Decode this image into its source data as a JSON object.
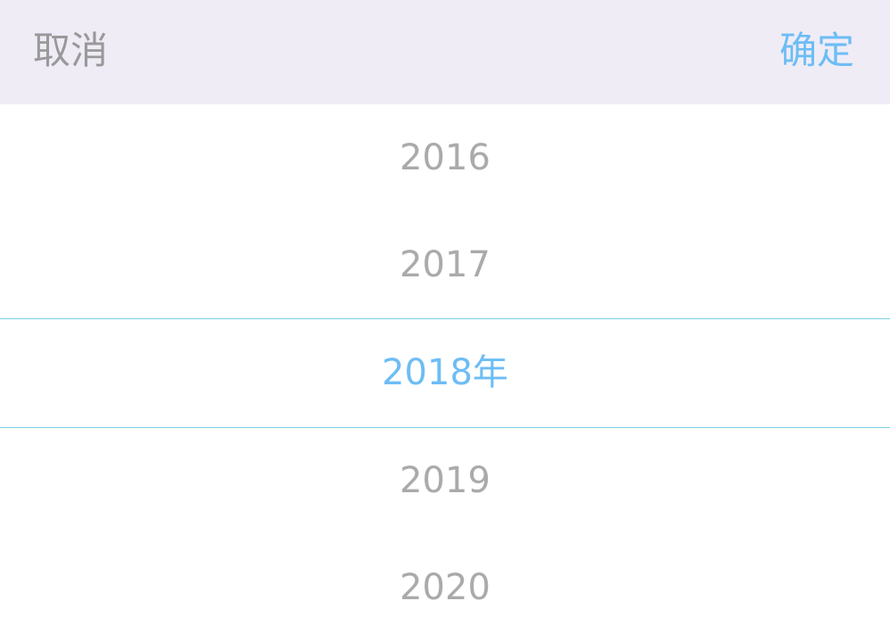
{
  "toolbar": {
    "cancel_label": "取消",
    "confirm_label": "确定"
  },
  "picker": {
    "options": [
      "2016",
      "2017",
      "2018",
      "2019",
      "2020"
    ],
    "selected_value": "2018",
    "selected_unit": "年"
  },
  "colors": {
    "toolbar_bg": "#efecf6",
    "accent": "#6dbdf5",
    "muted_text": "#aaaaaa",
    "cancel_text": "#999999",
    "selection_line": "#79cfe6"
  }
}
